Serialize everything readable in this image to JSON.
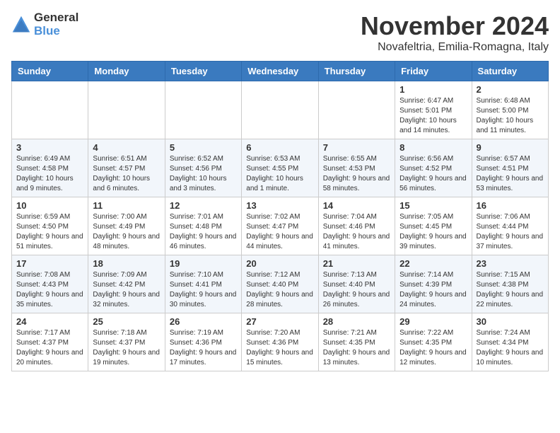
{
  "logo": {
    "text_general": "General",
    "text_blue": "Blue"
  },
  "title": {
    "month": "November 2024",
    "location": "Novafeltria, Emilia-Romagna, Italy"
  },
  "headers": [
    "Sunday",
    "Monday",
    "Tuesday",
    "Wednesday",
    "Thursday",
    "Friday",
    "Saturday"
  ],
  "weeks": [
    [
      {
        "day": "",
        "sunrise": "",
        "sunset": "",
        "daylight": ""
      },
      {
        "day": "",
        "sunrise": "",
        "sunset": "",
        "daylight": ""
      },
      {
        "day": "",
        "sunrise": "",
        "sunset": "",
        "daylight": ""
      },
      {
        "day": "",
        "sunrise": "",
        "sunset": "",
        "daylight": ""
      },
      {
        "day": "",
        "sunrise": "",
        "sunset": "",
        "daylight": ""
      },
      {
        "day": "1",
        "sunrise": "Sunrise: 6:47 AM",
        "sunset": "Sunset: 5:01 PM",
        "daylight": "Daylight: 10 hours and 14 minutes."
      },
      {
        "day": "2",
        "sunrise": "Sunrise: 6:48 AM",
        "sunset": "Sunset: 5:00 PM",
        "daylight": "Daylight: 10 hours and 11 minutes."
      }
    ],
    [
      {
        "day": "3",
        "sunrise": "Sunrise: 6:49 AM",
        "sunset": "Sunset: 4:58 PM",
        "daylight": "Daylight: 10 hours and 9 minutes."
      },
      {
        "day": "4",
        "sunrise": "Sunrise: 6:51 AM",
        "sunset": "Sunset: 4:57 PM",
        "daylight": "Daylight: 10 hours and 6 minutes."
      },
      {
        "day": "5",
        "sunrise": "Sunrise: 6:52 AM",
        "sunset": "Sunset: 4:56 PM",
        "daylight": "Daylight: 10 hours and 3 minutes."
      },
      {
        "day": "6",
        "sunrise": "Sunrise: 6:53 AM",
        "sunset": "Sunset: 4:55 PM",
        "daylight": "Daylight: 10 hours and 1 minute."
      },
      {
        "day": "7",
        "sunrise": "Sunrise: 6:55 AM",
        "sunset": "Sunset: 4:53 PM",
        "daylight": "Daylight: 9 hours and 58 minutes."
      },
      {
        "day": "8",
        "sunrise": "Sunrise: 6:56 AM",
        "sunset": "Sunset: 4:52 PM",
        "daylight": "Daylight: 9 hours and 56 minutes."
      },
      {
        "day": "9",
        "sunrise": "Sunrise: 6:57 AM",
        "sunset": "Sunset: 4:51 PM",
        "daylight": "Daylight: 9 hours and 53 minutes."
      }
    ],
    [
      {
        "day": "10",
        "sunrise": "Sunrise: 6:59 AM",
        "sunset": "Sunset: 4:50 PM",
        "daylight": "Daylight: 9 hours and 51 minutes."
      },
      {
        "day": "11",
        "sunrise": "Sunrise: 7:00 AM",
        "sunset": "Sunset: 4:49 PM",
        "daylight": "Daylight: 9 hours and 48 minutes."
      },
      {
        "day": "12",
        "sunrise": "Sunrise: 7:01 AM",
        "sunset": "Sunset: 4:48 PM",
        "daylight": "Daylight: 9 hours and 46 minutes."
      },
      {
        "day": "13",
        "sunrise": "Sunrise: 7:02 AM",
        "sunset": "Sunset: 4:47 PM",
        "daylight": "Daylight: 9 hours and 44 minutes."
      },
      {
        "day": "14",
        "sunrise": "Sunrise: 7:04 AM",
        "sunset": "Sunset: 4:46 PM",
        "daylight": "Daylight: 9 hours and 41 minutes."
      },
      {
        "day": "15",
        "sunrise": "Sunrise: 7:05 AM",
        "sunset": "Sunset: 4:45 PM",
        "daylight": "Daylight: 9 hours and 39 minutes."
      },
      {
        "day": "16",
        "sunrise": "Sunrise: 7:06 AM",
        "sunset": "Sunset: 4:44 PM",
        "daylight": "Daylight: 9 hours and 37 minutes."
      }
    ],
    [
      {
        "day": "17",
        "sunrise": "Sunrise: 7:08 AM",
        "sunset": "Sunset: 4:43 PM",
        "daylight": "Daylight: 9 hours and 35 minutes."
      },
      {
        "day": "18",
        "sunrise": "Sunrise: 7:09 AM",
        "sunset": "Sunset: 4:42 PM",
        "daylight": "Daylight: 9 hours and 32 minutes."
      },
      {
        "day": "19",
        "sunrise": "Sunrise: 7:10 AM",
        "sunset": "Sunset: 4:41 PM",
        "daylight": "Daylight: 9 hours and 30 minutes."
      },
      {
        "day": "20",
        "sunrise": "Sunrise: 7:12 AM",
        "sunset": "Sunset: 4:40 PM",
        "daylight": "Daylight: 9 hours and 28 minutes."
      },
      {
        "day": "21",
        "sunrise": "Sunrise: 7:13 AM",
        "sunset": "Sunset: 4:40 PM",
        "daylight": "Daylight: 9 hours and 26 minutes."
      },
      {
        "day": "22",
        "sunrise": "Sunrise: 7:14 AM",
        "sunset": "Sunset: 4:39 PM",
        "daylight": "Daylight: 9 hours and 24 minutes."
      },
      {
        "day": "23",
        "sunrise": "Sunrise: 7:15 AM",
        "sunset": "Sunset: 4:38 PM",
        "daylight": "Daylight: 9 hours and 22 minutes."
      }
    ],
    [
      {
        "day": "24",
        "sunrise": "Sunrise: 7:17 AM",
        "sunset": "Sunset: 4:37 PM",
        "daylight": "Daylight: 9 hours and 20 minutes."
      },
      {
        "day": "25",
        "sunrise": "Sunrise: 7:18 AM",
        "sunset": "Sunset: 4:37 PM",
        "daylight": "Daylight: 9 hours and 19 minutes."
      },
      {
        "day": "26",
        "sunrise": "Sunrise: 7:19 AM",
        "sunset": "Sunset: 4:36 PM",
        "daylight": "Daylight: 9 hours and 17 minutes."
      },
      {
        "day": "27",
        "sunrise": "Sunrise: 7:20 AM",
        "sunset": "Sunset: 4:36 PM",
        "daylight": "Daylight: 9 hours and 15 minutes."
      },
      {
        "day": "28",
        "sunrise": "Sunrise: 7:21 AM",
        "sunset": "Sunset: 4:35 PM",
        "daylight": "Daylight: 9 hours and 13 minutes."
      },
      {
        "day": "29",
        "sunrise": "Sunrise: 7:22 AM",
        "sunset": "Sunset: 4:35 PM",
        "daylight": "Daylight: 9 hours and 12 minutes."
      },
      {
        "day": "30",
        "sunrise": "Sunrise: 7:24 AM",
        "sunset": "Sunset: 4:34 PM",
        "daylight": "Daylight: 9 hours and 10 minutes."
      }
    ]
  ]
}
